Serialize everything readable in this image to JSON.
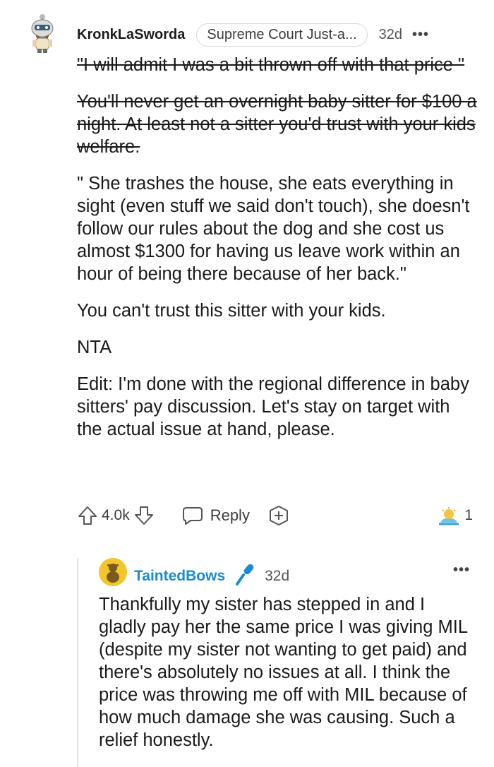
{
  "comment": {
    "username": "KronkLaSworda",
    "flair": "Supreme Court Just-a...",
    "time": "32d",
    "more": "•••",
    "paragraphs": [
      {
        "text": "\"I will admit I was a bit thrown off with that price \"",
        "strike": true
      },
      {
        "text": "You'll never get an overnight baby sitter for $100 a night. At least not a sitter you'd trust with your kids welfare.",
        "strike": true
      },
      {
        "text": "\" She trashes the house, she eats everything in sight (even stuff we said don't touch), she doesn't follow our rules about the dog and she cost us almost $1300 for having us leave work within an hour of being there because of her back.\"",
        "strike": false
      },
      {
        "text": "You can't trust this sitter with your kids.",
        "strike": false
      },
      {
        "text": "NTA",
        "strike": false
      },
      {
        "text": "Edit: I'm done with the regional difference in baby sitters' pay discussion. Let's stay on target with the actual issue at hand, please.",
        "strike": false
      }
    ],
    "actions": {
      "score": "4.0k",
      "reply_label": "Reply",
      "award_count": "1"
    }
  },
  "reply": {
    "username": "TaintedBows",
    "time": "32d",
    "more": "•••",
    "text": "Thankfully my sister has stepped in and I gladly pay her the same price I was giving MIL (despite my sister not wanting to get paid) and there's absolutely no issues at all. I think the price was throwing me off with MIL because of how much damage she was causing. Such a relief honestly."
  },
  "colors": {
    "username_link": "#1a8bd1",
    "mic": "#1a8bd1",
    "avatar_yellow": "#f2c62b"
  },
  "icons": [
    "upvote-icon",
    "downvote-icon",
    "comment-bubble-icon",
    "add-award-icon",
    "award-icon",
    "microphone-icon",
    "more-icon"
  ]
}
